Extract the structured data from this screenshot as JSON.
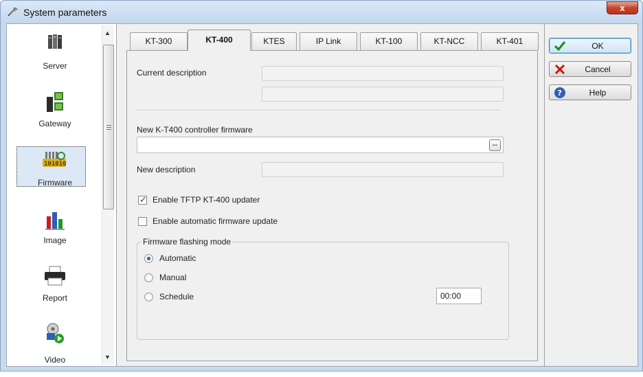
{
  "window": {
    "title": "System parameters",
    "close_label": "x"
  },
  "sidebar": {
    "items": [
      {
        "label": "Server",
        "icon": "server-icon"
      },
      {
        "label": "Gateway",
        "icon": "gateway-icon"
      },
      {
        "label": "Firmware",
        "icon": "firmware-icon",
        "selected": true
      },
      {
        "label": "Image",
        "icon": "image-icon"
      },
      {
        "label": "Report",
        "icon": "printer-icon"
      },
      {
        "label": "Video",
        "icon": "video-icon"
      }
    ]
  },
  "tabs": [
    {
      "label": "KT-300"
    },
    {
      "label": "KT-400",
      "active": true
    },
    {
      "label": "KTES"
    },
    {
      "label": "IP Link"
    },
    {
      "label": "KT-100"
    },
    {
      "label": "KT-NCC"
    },
    {
      "label": "KT-401"
    }
  ],
  "panel": {
    "current_description_label": "Current description",
    "current_description_value_1": "",
    "current_description_value_2": "",
    "new_firmware_label": "New K-T400 controller firmware",
    "new_firmware_value": "",
    "browse_label": "...",
    "new_description_label": "New description",
    "new_description_value": "",
    "enable_tftp_label": "Enable TFTP KT-400 updater",
    "enable_tftp_checked": true,
    "enable_auto_update_label": "Enable automatic firmware update",
    "enable_auto_update_checked": false,
    "flashing_group_title": "Firmware flashing mode",
    "mode_automatic_label": "Automatic",
    "mode_manual_label": "Manual",
    "mode_schedule_label": "Schedule",
    "selected_mode": "Automatic",
    "schedule_time": "00:00"
  },
  "buttons": {
    "ok_label": "OK",
    "cancel_label": "Cancel",
    "help_label": "Help"
  },
  "colors": {
    "titlebar": "#c4d7ee",
    "close": "#c8442c",
    "selection": "#dde8f7",
    "ok_check": "#1c8a1c",
    "cancel_x": "#c81414",
    "help": "#2f5fb3"
  }
}
